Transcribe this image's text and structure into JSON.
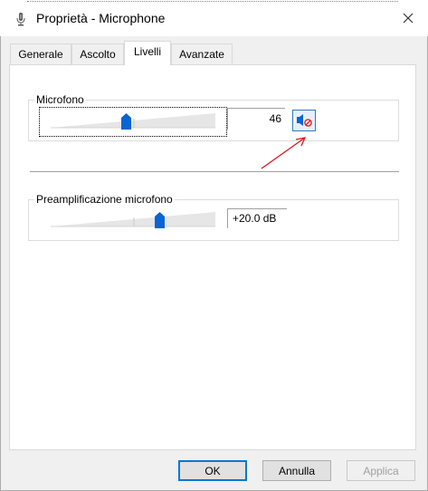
{
  "window": {
    "title": "Proprietà - Microphone",
    "close_glyph": "✕",
    "icon": "microphone-icon"
  },
  "tabs": [
    {
      "label": "Generale",
      "active": false
    },
    {
      "label": "Ascolto",
      "active": false
    },
    {
      "label": "Livelli",
      "active": true
    },
    {
      "label": "Avanzate",
      "active": false
    }
  ],
  "microphone_group": {
    "label": "Microfono",
    "level": 46,
    "level_max": 100,
    "value_text": "46",
    "mute_icon": "speaker-mute-icon"
  },
  "boost_group": {
    "label": "Preamplificazione microfono",
    "value_text": "+20.0 dB",
    "level_fraction": 0.66
  },
  "annotation": {
    "arrow_color": "#e0141e"
  },
  "buttons": {
    "ok": "OK",
    "cancel": "Annulla",
    "apply": "Applica"
  },
  "colors": {
    "accent": "#0078d7",
    "thumb": "#0a64d2"
  }
}
